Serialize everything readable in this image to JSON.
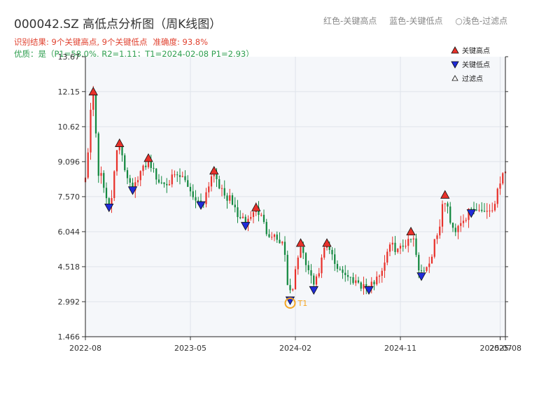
{
  "header": {
    "title": "000042.SZ 高低点分析图（周K线图）",
    "legend_text": [
      "红色-关键高点",
      "蓝色-关键低点",
      "○浅色-过滤点"
    ],
    "result": "识别结果: 9个关键高点, 9个关键低点",
    "accuracy": "准确度: 93.8%",
    "quality": "优质：是（P1=58.0%, R2=1.11；T1=2024-02-08 P1=2.93）"
  },
  "colors": {
    "up": "#e8312a",
    "down": "#12883f",
    "high_marker": "#e8312a",
    "low_marker": "#1f2bd8",
    "t1_ring": "#f5a623",
    "plot_bg": "#f5f7fa",
    "grid": "#dfe3ea",
    "info": "#e0412f",
    "quality": "#2e9e4f"
  },
  "chart_data": {
    "type": "candlestick",
    "title": "000042.SZ 高低点分析图（周K线图）",
    "y_ticks": [
      "1.466",
      "2.992",
      "4.518",
      "6.044",
      "7.570",
      "9.096",
      "10.62",
      "12.15",
      "13.67"
    ],
    "ylim": [
      1.466,
      13.67
    ],
    "x_ticks": [
      {
        "date": "2022-08",
        "index": 0
      },
      {
        "date": "2023-05",
        "index": 40
      },
      {
        "date": "2024-02",
        "index": 80
      },
      {
        "date": "2024-11",
        "index": 120
      },
      {
        "date": "2025-07",
        "index": 158
      },
      {
        "date": "2025-08",
        "index": 160
      }
    ],
    "grid": true,
    "legend": {
      "placement": "top-right",
      "entries": [
        {
          "label": "关键高点",
          "marker": "high"
        },
        {
          "label": "关键低点",
          "marker": "low"
        },
        {
          "label": "过滤点",
          "marker": "filtered"
        }
      ]
    },
    "key_highs": [
      {
        "index": 3,
        "price": 12.15
      },
      {
        "index": 13,
        "price": 9.9
      },
      {
        "index": 24,
        "price": 9.25
      },
      {
        "index": 49,
        "price": 8.7
      },
      {
        "index": 65,
        "price": 7.1
      },
      {
        "index": 82,
        "price": 5.55
      },
      {
        "index": 92,
        "price": 5.55
      },
      {
        "index": 124,
        "price": 6.05
      },
      {
        "index": 137,
        "price": 7.65
      }
    ],
    "key_lows": [
      {
        "index": 9,
        "price": 7.1
      },
      {
        "index": 18,
        "price": 7.85
      },
      {
        "index": 44,
        "price": 7.2
      },
      {
        "index": 61,
        "price": 6.3
      },
      {
        "index": 78,
        "price": 3.05
      },
      {
        "index": 87,
        "price": 3.5
      },
      {
        "index": 108,
        "price": 3.5
      },
      {
        "index": 128,
        "price": 4.1
      },
      {
        "index": 147,
        "price": 6.85
      }
    ],
    "t1": {
      "index": 78,
      "price": 2.93,
      "label": "T1"
    },
    "anchors": [
      [
        0,
        8.6
      ],
      [
        3,
        12.15
      ],
      [
        5,
        8.6
      ],
      [
        9,
        7.3
      ],
      [
        13,
        9.8
      ],
      [
        16,
        8.5
      ],
      [
        18,
        8.0
      ],
      [
        24,
        9.1
      ],
      [
        28,
        8.2
      ],
      [
        36,
        8.4
      ],
      [
        44,
        7.3
      ],
      [
        49,
        8.6
      ],
      [
        53,
        7.6
      ],
      [
        61,
        6.45
      ],
      [
        65,
        7.0
      ],
      [
        70,
        6.0
      ],
      [
        75,
        5.6
      ],
      [
        78,
        3.3
      ],
      [
        82,
        5.3
      ],
      [
        84,
        4.6
      ],
      [
        87,
        3.75
      ],
      [
        92,
        5.35
      ],
      [
        96,
        4.5
      ],
      [
        101,
        4.0
      ],
      [
        108,
        3.6
      ],
      [
        112,
        4.2
      ],
      [
        116,
        5.4
      ],
      [
        120,
        5.3
      ],
      [
        124,
        5.85
      ],
      [
        128,
        4.3
      ],
      [
        131,
        4.7
      ],
      [
        134,
        6.0
      ],
      [
        137,
        7.4
      ],
      [
        140,
        6.1
      ],
      [
        144,
        6.6
      ],
      [
        147,
        6.95
      ],
      [
        150,
        7.0
      ],
      [
        155,
        7.0
      ],
      [
        158,
        8.3
      ],
      [
        160,
        8.7
      ]
    ]
  }
}
